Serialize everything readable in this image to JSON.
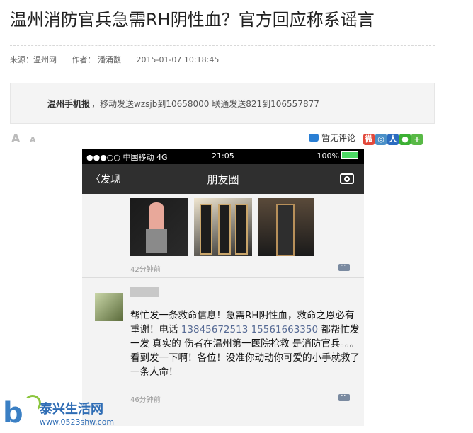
{
  "article": {
    "title": "温州消防官兵急需RH阴性血？官方回应称系谣言",
    "meta": {
      "source": "来源：温州网",
      "author": "作者：  潘涌馥",
      "datetime": "2015-01-07 10:18:45"
    },
    "promo": {
      "brand": "温州手机报",
      "text": "，移动发送wzsjb到10658000 联通发送821到106557877"
    },
    "toolbar": {
      "font_large": "A",
      "font_small": "A",
      "comment_label": "暂无评论"
    }
  },
  "share_icons": [
    "weibo-icon",
    "qzone-icon",
    "renren-icon",
    "wechat-icon",
    "plus-icon"
  ],
  "screenshot": {
    "status": {
      "carrier": "●●●○○ 中国移动  4G",
      "time": "21:05",
      "battery": "100%"
    },
    "nav": {
      "back": "〈发现",
      "title": "朋友圈"
    },
    "post1": {
      "time": "42分钟前"
    },
    "post2": {
      "text_before": "帮忙发一条救命信息！急需RH阴性血，救命之恩必有重谢！电话 ",
      "phone1": "13845672513",
      "phone2": "15561663350",
      "text_after": " 都帮忙发一发 真实的 伤者在温州第一医院抢救 是消防官兵。。。看到发一下啊！各位！没准你动动你可爱的小手就救了一条人命！",
      "time": "46分钟前"
    }
  },
  "watermark": {
    "name": "泰兴生活网",
    "url": "www.0523shw.com"
  },
  "colors": {
    "link_blue": "#576b95",
    "nav_bg": "#2f2f2f",
    "watermark_blue": "#2f6db5"
  }
}
